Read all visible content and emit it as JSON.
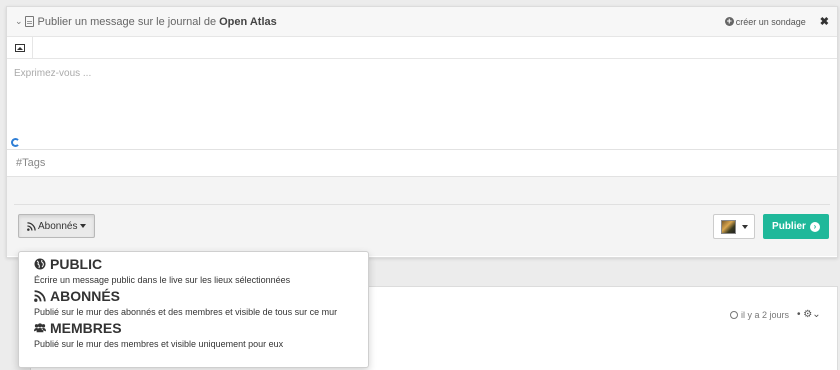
{
  "header": {
    "title_prefix": "Publier un message sur le journal de",
    "org": "Open Atlas",
    "survey_label": "créer un sondage",
    "close_glyph": "✖"
  },
  "composer": {
    "placeholder": "Exprimez-vous ...",
    "tags_placeholder": "#Tags"
  },
  "footer": {
    "audience_label": "Abonnés",
    "publish_label": "Publier"
  },
  "audience_menu": [
    {
      "title": "PUBLIC",
      "icon": "globe-icon",
      "desc": "Écrire un message public dans le live sur les lieux sélectionnées"
    },
    {
      "title": "ABONNÉS",
      "icon": "rss-icon",
      "desc": "Publié sur le mur des abonnés et des membres et visible de tous sur ce mur"
    },
    {
      "title": "MEMBRES",
      "icon": "users-icon",
      "desc": "Publié sur le mur des membres et visible uniquement pour eux"
    }
  ],
  "post": {
    "time": "il y a 2 jours"
  },
  "colors": {
    "publish": "#1fb89a",
    "spinner": "#2f7fd6"
  }
}
